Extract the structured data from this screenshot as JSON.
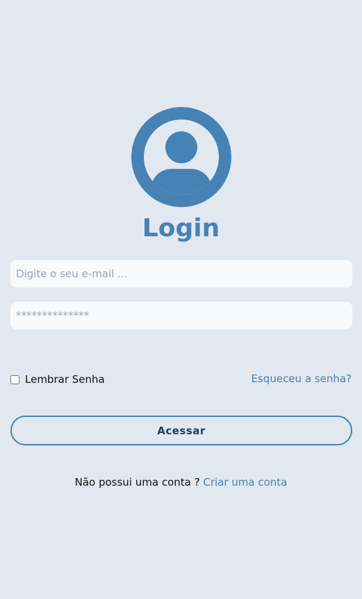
{
  "login": {
    "title": "Login",
    "avatar_icon": "user-circle-icon",
    "accent_color": "#4682b4",
    "email": {
      "placeholder": "Digite o seu e-mail ...",
      "value": ""
    },
    "password": {
      "placeholder": "**************",
      "value": ""
    },
    "remember": {
      "label": "Lembrar Senha",
      "checked": false
    },
    "forgot_link": "Esqueceu a senha?",
    "submit_label": "Acessar",
    "signup": {
      "prompt": "Não possui uma conta ?",
      "link": "Criar uma conta"
    }
  }
}
